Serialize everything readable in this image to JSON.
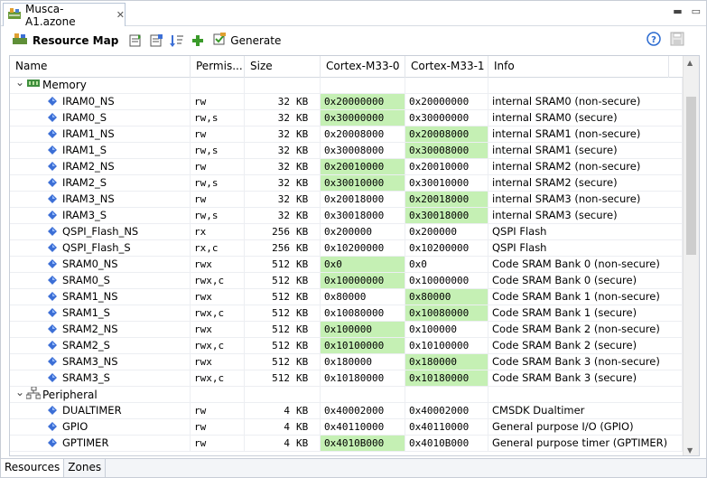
{
  "tab": {
    "title": "Musca-A1.azone"
  },
  "toolbar": {
    "title": "Resource Map",
    "generate": "Generate"
  },
  "columns": [
    "Name",
    "Permis...",
    "Size",
    "Cortex-M33-0",
    "Cortex-M33-1",
    "Info"
  ],
  "groups": [
    {
      "label": "Memory",
      "icon": "memory-icon"
    },
    {
      "label": "Peripheral",
      "icon": "peripheral-icon"
    }
  ],
  "memory_rows": [
    {
      "name": "IRAM0_NS",
      "perm": "rw",
      "size": "32",
      "unit": "KB",
      "c0": "0x20000000",
      "c1": "0x20000000",
      "info": "internal SRAM0 (non-secure)",
      "hl": 0
    },
    {
      "name": "IRAM0_S",
      "perm": "rw,s",
      "size": "32",
      "unit": "KB",
      "c0": "0x30000000",
      "c1": "0x30000000",
      "info": "internal SRAM0 (secure)",
      "hl": 0
    },
    {
      "name": "IRAM1_NS",
      "perm": "rw",
      "size": "32",
      "unit": "KB",
      "c0": "0x20008000",
      "c1": "0x20008000",
      "info": "internal SRAM1 (non-secure)",
      "hl": 1
    },
    {
      "name": "IRAM1_S",
      "perm": "rw,s",
      "size": "32",
      "unit": "KB",
      "c0": "0x30008000",
      "c1": "0x30008000",
      "info": "internal SRAM1 (secure)",
      "hl": 1
    },
    {
      "name": "IRAM2_NS",
      "perm": "rw",
      "size": "32",
      "unit": "KB",
      "c0": "0x20010000",
      "c1": "0x20010000",
      "info": "internal SRAM2 (non-secure)",
      "hl": 0
    },
    {
      "name": "IRAM2_S",
      "perm": "rw,s",
      "size": "32",
      "unit": "KB",
      "c0": "0x30010000",
      "c1": "0x30010000",
      "info": "internal SRAM2 (secure)",
      "hl": 0
    },
    {
      "name": "IRAM3_NS",
      "perm": "rw",
      "size": "32",
      "unit": "KB",
      "c0": "0x20018000",
      "c1": "0x20018000",
      "info": "internal SRAM3 (non-secure)",
      "hl": 1
    },
    {
      "name": "IRAM3_S",
      "perm": "rw,s",
      "size": "32",
      "unit": "KB",
      "c0": "0x30018000",
      "c1": "0x30018000",
      "info": "internal SRAM3 (secure)",
      "hl": 1
    },
    {
      "name": "QSPI_Flash_NS",
      "perm": "rx",
      "size": "256",
      "unit": "KB",
      "c0": "0x200000",
      "c1": "0x200000",
      "info": "QSPI Flash",
      "hl": -1
    },
    {
      "name": "QSPI_Flash_S",
      "perm": "rx,c",
      "size": "256",
      "unit": "KB",
      "c0": "0x10200000",
      "c1": "0x10200000",
      "info": "QSPI Flash",
      "hl": -1
    },
    {
      "name": "SRAM0_NS",
      "perm": "rwx",
      "size": "512",
      "unit": "KB",
      "c0": "0x0",
      "c1": "0x0",
      "info": "Code SRAM Bank 0 (non-secure)",
      "hl": 0
    },
    {
      "name": "SRAM0_S",
      "perm": "rwx,c",
      "size": "512",
      "unit": "KB",
      "c0": "0x10000000",
      "c1": "0x10000000",
      "info": "Code SRAM Bank 0 (secure)",
      "hl": 0
    },
    {
      "name": "SRAM1_NS",
      "perm": "rwx",
      "size": "512",
      "unit": "KB",
      "c0": "0x80000",
      "c1": "0x80000",
      "info": "Code SRAM Bank 1 (non-secure)",
      "hl": 1
    },
    {
      "name": "SRAM1_S",
      "perm": "rwx,c",
      "size": "512",
      "unit": "KB",
      "c0": "0x10080000",
      "c1": "0x10080000",
      "info": "Code SRAM Bank 1 (secure)",
      "hl": 1
    },
    {
      "name": "SRAM2_NS",
      "perm": "rwx",
      "size": "512",
      "unit": "KB",
      "c0": "0x100000",
      "c1": "0x100000",
      "info": "Code SRAM Bank 2 (non-secure)",
      "hl": 0
    },
    {
      "name": "SRAM2_S",
      "perm": "rwx,c",
      "size": "512",
      "unit": "KB",
      "c0": "0x10100000",
      "c1": "0x10100000",
      "info": "Code SRAM Bank 2 (secure)",
      "hl": 0
    },
    {
      "name": "SRAM3_NS",
      "perm": "rwx",
      "size": "512",
      "unit": "KB",
      "c0": "0x180000",
      "c1": "0x180000",
      "info": "Code SRAM Bank 3 (non-secure)",
      "hl": 1
    },
    {
      "name": "SRAM3_S",
      "perm": "rwx,c",
      "size": "512",
      "unit": "KB",
      "c0": "0x10180000",
      "c1": "0x10180000",
      "info": "Code SRAM Bank 3 (secure)",
      "hl": 1
    }
  ],
  "peripheral_rows": [
    {
      "name": "DUALTIMER",
      "perm": "rw",
      "size": "4",
      "unit": "KB",
      "c0": "0x40002000",
      "c1": "0x40002000",
      "info": "CMSDK Dualtimer",
      "hl": -1
    },
    {
      "name": "GPIO",
      "perm": "rw",
      "size": "4",
      "unit": "KB",
      "c0": "0x40110000",
      "c1": "0x40110000",
      "info": "General purpose I/O (GPIO)",
      "hl": -1
    },
    {
      "name": "GPTIMER",
      "perm": "rw",
      "size": "4",
      "unit": "KB",
      "c0": "0x4010B000",
      "c1": "0x4010B000",
      "info": "General purpose timer (GPTIMER)",
      "hl": 0
    }
  ],
  "bottom_tabs": [
    "Resources",
    "Zones"
  ],
  "colors": {
    "highlight": "#c5f0b4",
    "element_icon": "#3c6fd6"
  }
}
